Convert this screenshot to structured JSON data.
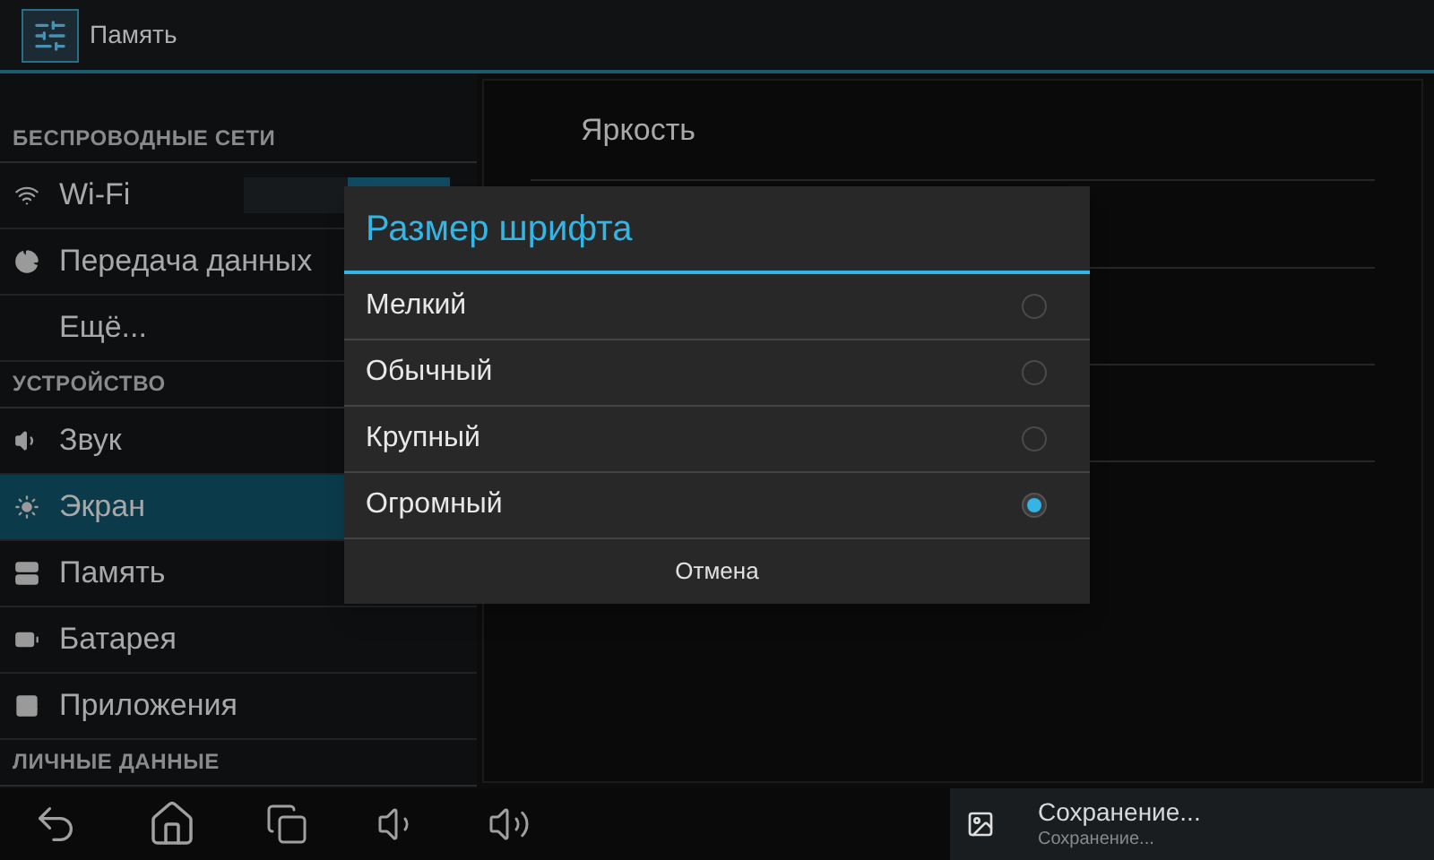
{
  "action_bar": {
    "title": "Память"
  },
  "sidebar": {
    "items": [
      {
        "kind": "header",
        "label": "БЕСПРОВОДНЫЕ СЕТИ"
      },
      {
        "kind": "item",
        "label": "Wi-Fi",
        "selected": false,
        "switch_on": true
      },
      {
        "kind": "item",
        "label": "Передача данных",
        "selected": false
      },
      {
        "kind": "item",
        "label": "Ещё...",
        "selected": false
      },
      {
        "kind": "header",
        "label": "УСТРОЙСТВО"
      },
      {
        "kind": "item",
        "label": "Звук",
        "selected": false
      },
      {
        "kind": "item",
        "label": "Экран",
        "selected": true
      },
      {
        "kind": "item",
        "label": "Память",
        "selected": false
      },
      {
        "kind": "item",
        "label": "Батарея",
        "selected": false
      },
      {
        "kind": "item",
        "label": "Приложения",
        "selected": false
      },
      {
        "kind": "header",
        "label": "ЛИЧНЫЕ ДАННЫЕ"
      }
    ]
  },
  "detail": {
    "first_row": "Яркость"
  },
  "dialog": {
    "title": "Размер шрифта",
    "options": [
      {
        "label": "Мелкий",
        "selected": false
      },
      {
        "label": "Обычный",
        "selected": false
      },
      {
        "label": "Крупный",
        "selected": false
      },
      {
        "label": "Огромный",
        "selected": true
      }
    ],
    "cancel": "Отмена"
  },
  "notification": {
    "title": "Сохранение...",
    "text": "Сохранение..."
  }
}
